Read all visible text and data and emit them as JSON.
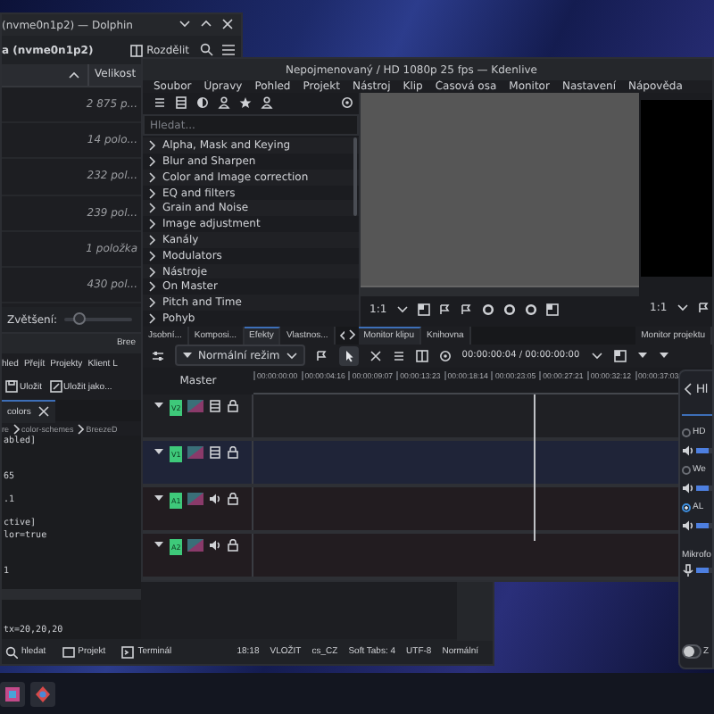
{
  "dolphin": {
    "title": "(nvme0n1p2) — Dolphin",
    "location": "a (nvme0n1p2)",
    "split_button": "Rozdělit",
    "column": "Velikost",
    "rows": [
      "2 875 p...",
      "14 polo...",
      "232 pol...",
      "239 pol...",
      "1 položka",
      "430 pol..."
    ],
    "zoom_label": "Zvětšení:",
    "zoom": {
      "level": 0.2
    }
  },
  "kate": {
    "title": "Bree",
    "menu": [
      "hled",
      "Přejít",
      "Projekty",
      "Klient L"
    ],
    "toolbar": [
      "Uložit",
      "Uložit jako..."
    ],
    "tab": "colors",
    "breadcrumb": [
      "re",
      "color-schemes",
      "BreezeD"
    ],
    "lines": [
      {
        "kind": "text",
        "text": "abled]"
      },
      {
        "kind": "blank"
      },
      {
        "kind": "blank"
      },
      {
        "kind": "text",
        "text": "65"
      },
      {
        "kind": "blank"
      },
      {
        "kind": "text",
        "text": ".1"
      },
      {
        "kind": "blank"
      },
      {
        "kind": "text",
        "text": "ctive]"
      },
      {
        "kind": "text",
        "text": "lor=true"
      },
      {
        "kind": "blank"
      },
      {
        "kind": "blank"
      },
      {
        "kind": "text",
        "text": "1"
      },
      {
        "kind": "blank"
      },
      {
        "kind": "current"
      },
      {
        "kind": "blank"
      },
      {
        "kind": "blank"
      },
      {
        "kind": "text",
        "text": "tx=20,20,20"
      }
    ],
    "status_left": [
      "hledat",
      "Projekt",
      "Terminál"
    ],
    "status_right": [
      "18:18",
      "VLOŽIT",
      "cs_CZ",
      "Soft Tabs: 4",
      "UTF-8",
      "Normální"
    ]
  },
  "kdenlive": {
    "title": "Nepojmenovaný / HD 1080p 25 fps — Kdenlive",
    "menu": [
      "Soubor",
      "Úpravy",
      "Pohled",
      "Projekt",
      "Nástroj",
      "Klip",
      "Časová osa",
      "Monitor",
      "Nastavení",
      "Nápověda"
    ],
    "search": {
      "placeholder": "Hledat..."
    },
    "effects": [
      {
        "label": "Alpha, Mask and Keying",
        "expanded": false
      },
      {
        "label": "Blur and Sharpen",
        "expanded": false
      },
      {
        "label": "Color and Image correction",
        "expanded": false
      },
      {
        "label": "EQ and filters",
        "expanded": false
      },
      {
        "label": "Grain and Noise",
        "expanded": false
      },
      {
        "label": "Image adjustment",
        "expanded": false
      },
      {
        "label": "Kanály",
        "expanded": false
      },
      {
        "label": "Modulators",
        "expanded": false
      },
      {
        "label": "Nástroje",
        "expanded": false
      },
      {
        "label": "On Master",
        "expanded": false
      },
      {
        "label": "Pitch and Time",
        "expanded": false
      },
      {
        "label": "Pohyb",
        "expanded": false
      }
    ],
    "panel_tabs": [
      {
        "label": "Jsobní...",
        "selected": false
      },
      {
        "label": "Komposi...",
        "selected": false
      },
      {
        "label": "Efekty",
        "selected": true
      },
      {
        "label": "Vlastnos...",
        "selected": false
      }
    ],
    "clip_monitor_zoom": "1:1",
    "project_monitor_zoom": "1:1",
    "monitor_tabs": [
      {
        "label": "Monitor klipu",
        "selected": true
      },
      {
        "label": "Knihovna",
        "selected": false
      }
    ],
    "project_monitor_tab": "Monitor projektu",
    "timeline": {
      "mode": "Normální režim",
      "timecode": "00:00:00:04 / 00:00:00:00",
      "master": "Master",
      "ruler": [
        "00:00:00:00",
        "00:00:04:16",
        "00:00:09:07",
        "00:00:13:23",
        "00:00:18:14",
        "00:00:23:05",
        "00:00:27:21",
        "00:00:32:12",
        "00:00:37:03"
      ],
      "tracks": [
        {
          "name": "V2",
          "kind": "video"
        },
        {
          "name": "V1",
          "kind": "video"
        },
        {
          "name": "A1",
          "kind": "audio"
        },
        {
          "name": "A2",
          "kind": "audio"
        }
      ]
    }
  },
  "audio_popup": {
    "title": "Hl",
    "devices": [
      {
        "label": "HD",
        "selected": false,
        "level": 0.6
      },
      {
        "label": "We",
        "selected": false,
        "level": 0.6
      },
      {
        "label": "AL",
        "selected": true,
        "level": 0.6
      }
    ],
    "microphone": {
      "label": "Mikrofo",
      "level": 0.6
    },
    "toggle": {
      "label": "Z",
      "on": false
    }
  }
}
